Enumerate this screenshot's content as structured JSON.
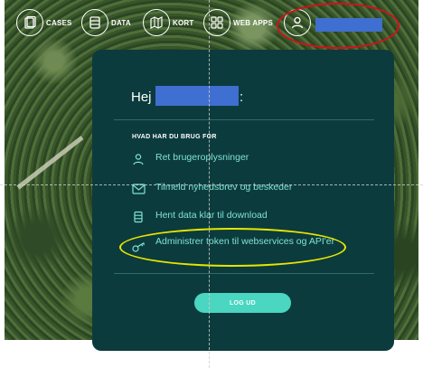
{
  "nav": {
    "items": [
      {
        "label": "CASES",
        "icon": "cases-icon"
      },
      {
        "label": "DATA",
        "icon": "data-icon"
      },
      {
        "label": "KORT",
        "icon": "map-icon"
      },
      {
        "label": "WEB APPS",
        "icon": "apps-grid-icon"
      }
    ],
    "user_icon": "user-icon"
  },
  "panel": {
    "greeting": "Hej",
    "colon": ":",
    "section_title": "HVAD HAR DU BRUG FOR",
    "menu": [
      {
        "label": "Ret brugeroplysninger",
        "icon": "user-icon"
      },
      {
        "label": "Tilmeld nyhedsbrev og beskeder",
        "icon": "mail-icon"
      },
      {
        "label": "Hent data klar til download",
        "icon": "database-icon"
      },
      {
        "label": "Administrer token til webservices og API'er",
        "icon": "key-icon"
      }
    ],
    "logout_label": "LOG UD"
  },
  "colors": {
    "panel_bg": "#0c3b3d",
    "accent": "#7fe3d4",
    "button": "#4ad6c1",
    "redaction": "#3f6fd1",
    "annotation_red": "#d2111a",
    "annotation_yellow": "#e6e600"
  }
}
